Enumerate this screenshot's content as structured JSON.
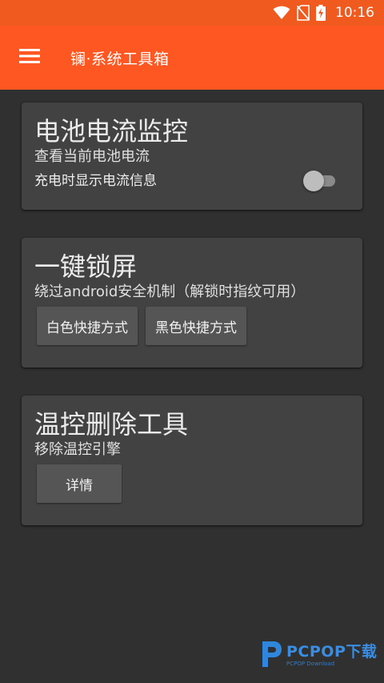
{
  "status_bar": {
    "time": "10:16",
    "icons": [
      "wifi-icon",
      "no-sim-icon",
      "battery-charging-icon"
    ]
  },
  "app_bar": {
    "title": "镧·系统工具箱",
    "menu_icon": "hamburger-menu-icon"
  },
  "cards": {
    "battery": {
      "title": "电池电流监控",
      "subtitle": "查看当前电池电流",
      "switch_label": "充电时显示电流信息",
      "switch_on": false
    },
    "lockscreen": {
      "title": "一键锁屏",
      "subtitle": "绕过android安全机制（解锁时指纹可用）",
      "buttons": [
        "白色快捷方式",
        "黑色快捷方式"
      ]
    },
    "thermal": {
      "title": "温控删除工具",
      "subtitle": "移除温控引擎",
      "button": "详情"
    }
  },
  "watermark": {
    "main": "PCPOP下载",
    "sub": "PCPOP Download"
  },
  "colors": {
    "status_bar": "#F05A1E",
    "app_bar": "#FF5722",
    "background": "#303030",
    "card": "#424242",
    "button": "#555555"
  }
}
